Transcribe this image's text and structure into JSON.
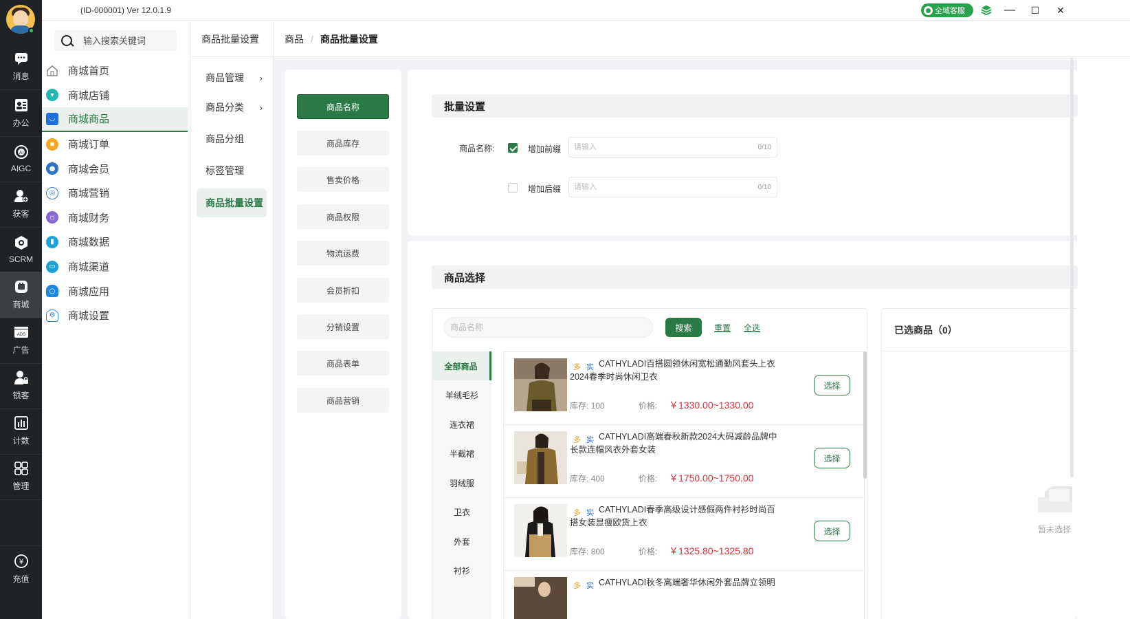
{
  "titlebar": {
    "version": "(ID-000001)  Ver 12.0.1.9",
    "service_label": "全域客服",
    "minimize": "—",
    "maximize": "☐",
    "close": "✕"
  },
  "rail": {
    "items": [
      {
        "label": "消息",
        "icon": "message-icon"
      },
      {
        "label": "办公",
        "icon": "office-icon"
      },
      {
        "label": "AIGC",
        "icon": "aigc-icon"
      },
      {
        "label": "获客",
        "icon": "acquire-customer-icon"
      },
      {
        "label": "SCRM",
        "icon": "scrm-icon"
      },
      {
        "label": "商城",
        "icon": "mall-icon"
      },
      {
        "label": "广告",
        "icon": "ads-icon"
      },
      {
        "label": "锁客",
        "icon": "lock-customer-icon"
      },
      {
        "label": "计数",
        "icon": "counter-icon"
      },
      {
        "label": "管理",
        "icon": "grid-icon"
      }
    ],
    "recharge": {
      "label": "充值",
      "icon": "recharge-icon"
    }
  },
  "sidebar": {
    "search_placeholder": "输入搜索关键词",
    "items": [
      {
        "label": "商城首页",
        "icon": "home-icon",
        "color": "#888888"
      },
      {
        "label": "商城店铺",
        "icon": "shop-icon",
        "color": "#1fb8b0"
      },
      {
        "label": "商城商品",
        "icon": "bag-icon",
        "color": "#1e6fd9"
      },
      {
        "label": "商城订单",
        "icon": "order-icon",
        "color": "#f5a623"
      },
      {
        "label": "商城会员",
        "icon": "members-icon",
        "color": "#2a72c8"
      },
      {
        "label": "商城营销",
        "icon": "marketing-icon",
        "color": "#3a7fd5"
      },
      {
        "label": "商城财务",
        "icon": "finance-icon",
        "color": "#8a67d6"
      },
      {
        "label": "商城数据",
        "icon": "data-icon",
        "color": "#1ba3d9"
      },
      {
        "label": "商城渠道",
        "icon": "channel-icon",
        "color": "#1ba3d9"
      },
      {
        "label": "商城应用",
        "icon": "cloud-icon",
        "color": "#1e88e5"
      },
      {
        "label": "商城设置",
        "icon": "settings-cloud-icon",
        "color": "#1e88e5"
      }
    ]
  },
  "subnav": {
    "header": "商品批量设置",
    "items": [
      {
        "label": "商品管理",
        "chevron": "›"
      },
      {
        "label": "商品分类",
        "chevron": "›"
      },
      {
        "label": "商品分组"
      },
      {
        "label": "标签管理"
      },
      {
        "label": "商品批量设置"
      }
    ]
  },
  "breadcrumb": {
    "parent": "商品",
    "separator": "/",
    "current": "商品批量设置"
  },
  "tabs": [
    "商品名称",
    "商品库存",
    "售卖价格",
    "商品权限",
    "物流运费",
    "会员折扣",
    "分销设置",
    "商品表单",
    "商品营销"
  ],
  "batch": {
    "title": "批量设置",
    "field_label": "商品名称:",
    "prefix": {
      "label": "增加前缀",
      "checked": true,
      "placeholder": "请输入",
      "count": "0/10"
    },
    "suffix": {
      "label": "增加后缀",
      "checked": false,
      "placeholder": "请输入",
      "count": "0/10"
    }
  },
  "selection": {
    "title": "商品选择",
    "search_placeholder": "商品名称",
    "search_button": "搜索",
    "reset": "重置",
    "select_all": "全选",
    "categories": [
      "全部商品",
      "羊绒毛衫",
      "连衣裙",
      "半截裙",
      "羽绒服",
      "卫衣",
      "外套",
      "衬衫"
    ],
    "products": [
      {
        "tag1": "多",
        "tag2": "实",
        "title": "CATHYLADI百搭圆领休闲宽松通勤风套头上衣2024春季时尚休闲卫衣",
        "stock_label": "库存:",
        "stock": "100",
        "price_label": "价格:",
        "price": "￥1330.00~1330.00",
        "button": "选择"
      },
      {
        "tag1": "多",
        "tag2": "实",
        "title": "CATHYLADI高端春秋新款2024大码减龄品牌中长款连帽风衣外套女装",
        "stock_label": "库存:",
        "stock": "400",
        "price_label": "价格:",
        "price": "￥1750.00~1750.00",
        "button": "选择"
      },
      {
        "tag1": "多",
        "tag2": "实",
        "title": "CATHYLADI春季高级设计感假两件衬衫时尚百搭女装显瘦欧货上衣",
        "stock_label": "库存:",
        "stock": "800",
        "price_label": "价格:",
        "price": "￥1325.80~1325.80",
        "button": "选择"
      },
      {
        "tag1": "多",
        "tag2": "实",
        "title": "CATHYLADI秋冬高端奢华休闲外套品牌立领明",
        "stock_label": "",
        "stock": "",
        "price_label": "",
        "price": "",
        "button": ""
      }
    ],
    "selected_title": "已选商品（0）",
    "empty_text": "暂未选择"
  },
  "colors": {
    "accent": "#2b7a46",
    "price": "#d8303b",
    "rail": "#1f2326"
  }
}
